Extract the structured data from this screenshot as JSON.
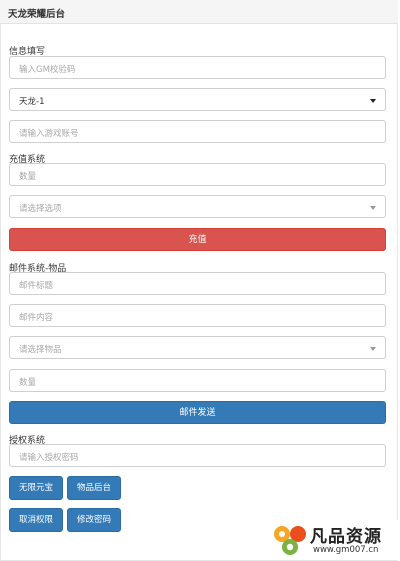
{
  "header": {
    "title": "天龙荣耀后台"
  },
  "info": {
    "label": "信息填写",
    "gm_code_placeholder": "输入GM校验码",
    "server_value": "天龙-1",
    "account_placeholder": "请输入游戏账号"
  },
  "recharge": {
    "label": "充值系统",
    "amount_placeholder": "数量",
    "option_placeholder": "请选择选项",
    "button": "充值"
  },
  "mail": {
    "label": "邮件系统-物品",
    "title_placeholder": "邮件标题",
    "content_placeholder": "邮件内容",
    "item_placeholder": "请选择物品",
    "amount_placeholder": "数量",
    "button": "邮件发送"
  },
  "auth": {
    "label": "授权系统",
    "password_placeholder": "请输入授权密码",
    "buttons": [
      "无限元宝",
      "物品后台",
      "取消权限",
      "修改密码"
    ]
  },
  "watermark": {
    "brand": "凡品资源",
    "url": "www.gm007.cn"
  },
  "colors": {
    "danger": "#d9534f",
    "primary": "#337ab7"
  }
}
